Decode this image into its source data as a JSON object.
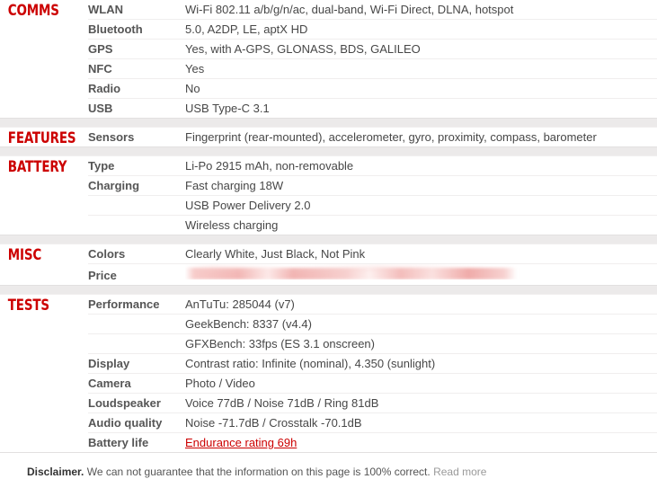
{
  "sections": [
    {
      "title": "COMMS",
      "rows": [
        {
          "label": "WLAN",
          "value": "Wi-Fi 802.11 a/b/g/n/ac, dual-band, Wi-Fi Direct, DLNA, hotspot"
        },
        {
          "label": "Bluetooth",
          "value": "5.0, A2DP, LE, aptX HD"
        },
        {
          "label": "GPS",
          "value": "Yes, with A-GPS, GLONASS, BDS, GALILEO"
        },
        {
          "label": "NFC",
          "value": "Yes"
        },
        {
          "label": "Radio",
          "value": "No"
        },
        {
          "label": "USB",
          "value": "USB Type-C 3.1"
        }
      ]
    },
    {
      "title": "FEATURES",
      "rows": [
        {
          "label": "Sensors",
          "value": "Fingerprint (rear-mounted), accelerometer, gyro, proximity, compass, barometer"
        }
      ]
    },
    {
      "title": "BATTERY",
      "rows": [
        {
          "label": "Type",
          "value": "Li-Po 2915 mAh, non-removable"
        },
        {
          "label": "Charging",
          "value": "Fast charging 18W"
        },
        {
          "label": "",
          "value": "USB Power Delivery 2.0"
        },
        {
          "label": "",
          "value": "Wireless charging"
        }
      ]
    },
    {
      "title": "MISC",
      "rows": [
        {
          "label": "Colors",
          "value": "Clearly White, Just Black, Not Pink"
        },
        {
          "label": "Price",
          "value": "",
          "redacted": true
        }
      ]
    },
    {
      "title": "TESTS",
      "rows": [
        {
          "label": "Performance",
          "value": "AnTuTu: 285044 (v7)"
        },
        {
          "label": "",
          "value": "GeekBench: 8337 (v4.4)"
        },
        {
          "label": "",
          "value": "GFXBench: 33fps (ES 3.1 onscreen)"
        },
        {
          "label": "Display",
          "value": "Contrast ratio: Infinite (nominal), 4.350 (sunlight)"
        },
        {
          "label": "Camera",
          "value": "Photo / Video"
        },
        {
          "label": "Loudspeaker",
          "value": "Voice 77dB / Noise 71dB / Ring 81dB"
        },
        {
          "label": "Audio quality",
          "value": "Noise -71.7dB / Crosstalk -70.1dB"
        },
        {
          "label": "Battery life",
          "value": "Endurance rating 69h",
          "link": true
        }
      ]
    }
  ],
  "disclaimer": {
    "strong": "Disclaimer.",
    "text": "We can not guarantee that the information on this page is 100% correct.",
    "read_more": "Read more"
  },
  "colors": {
    "section_title": "#cc0000",
    "link": "#cc0000",
    "label": "#555555",
    "value": "#474747",
    "row_separator": "#f0eeee",
    "section_gap": "#eceaea",
    "redaction": "#f0aaa8"
  }
}
